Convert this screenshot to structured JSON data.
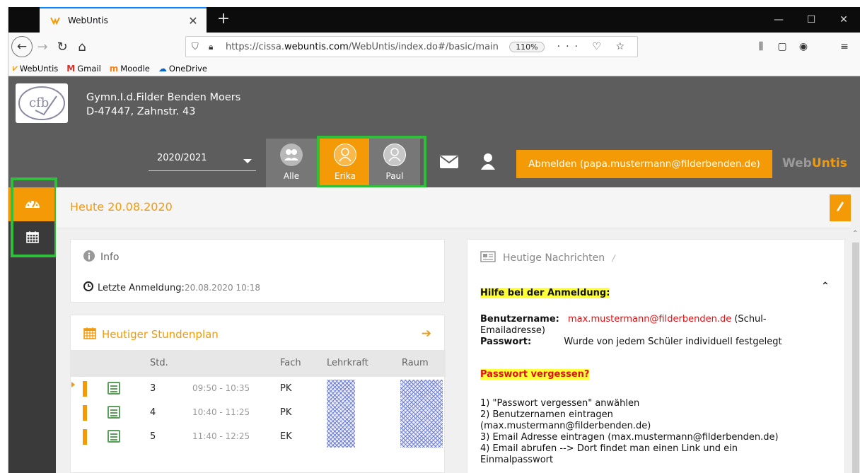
{
  "browser": {
    "tab_title": "WebUntis",
    "url_host_pre": "https://cissa.",
    "url_host": "webuntis.com",
    "url_path": "/WebUntis/index.do#/basic/main",
    "zoom": "110%",
    "bookmarks": [
      "WebUntis",
      "Gmail",
      "Moodle",
      "OneDrive"
    ]
  },
  "school": {
    "name": "Gymn.I.d.Filder Benden Moers",
    "address": "D-47447, Zahnstr. 43"
  },
  "header": {
    "year": "2020/2021",
    "persons": [
      "Alle",
      "Erika",
      "Paul"
    ],
    "logout": "Abmelden (papa.mustermann@filderbenden.de)",
    "brand_a": "Web",
    "brand_b": "Untis"
  },
  "today": {
    "title": "Heute 20.08.2020"
  },
  "info": {
    "title": "Info",
    "last_login_label": "Letzte Anmeldung:",
    "last_login_value": "20.08.2020 10:18"
  },
  "plan": {
    "title": "Heutiger Stundenplan",
    "headers": {
      "period": "Std.",
      "subject": "Fach",
      "teacher": "Lehrkraft",
      "room": "Raum"
    },
    "rows": [
      {
        "period": "3",
        "time": "09:50 - 10:35",
        "subject": "PK"
      },
      {
        "period": "4",
        "time": "10:40 - 11:25",
        "subject": "PK"
      },
      {
        "period": "5",
        "time": "11:40 - 12:25",
        "subject": "EK"
      }
    ]
  },
  "news": {
    "title": "Heutige Nachrichten",
    "help_title": "Hilfe bei der Anmeldung:",
    "username_label": "Benutzername:",
    "username_value": "max.mustermann@filderbenden.de",
    "username_suffix": "(Schul-",
    "username_suffix2": "Emailadresse)",
    "password_label": "Passwort:",
    "password_value": "Wurde von jedem Schüler individuell festgelegt",
    "forgot_title": "Passwort vergessen?",
    "steps": [
      "1) \"Passwort vergessen\" anwählen",
      "2) Benutzernamen eintragen",
      "(max.mustermann@filderbenden.de)",
      "3) Email Adresse eintragen (max.mustermann@filderbenden.de)",
      "4) Email abrufen --> Dort findet man einen Link und ein",
      "Einmalpasswort"
    ]
  }
}
